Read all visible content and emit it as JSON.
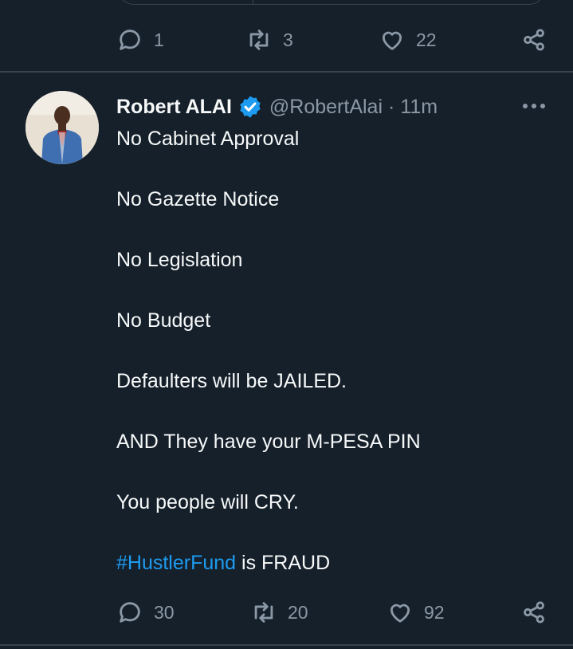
{
  "previous_tweet": {
    "actions": {
      "replies": "1",
      "retweets": "3",
      "likes": "22"
    }
  },
  "tweet": {
    "author": {
      "name": "Robert ALAI",
      "handle": "@RobertAlai"
    },
    "separator": "·",
    "time": "11m",
    "lines": [
      "No Cabinet Approval",
      "No Gazette Notice",
      "No Legislation",
      "No Budget",
      "Defaulters will be JAILED.",
      "AND They have your M-PESA PIN",
      "You people will CRY."
    ],
    "last_line": {
      "hashtag": "#HustlerFund",
      "rest": " is FRAUD"
    },
    "actions": {
      "replies": "30",
      "retweets": "20",
      "likes": "92"
    }
  },
  "colors": {
    "background": "#15202b",
    "text": "#f7f9f9",
    "muted": "#8b98a5",
    "accent": "#1d9bf0",
    "border": "#38444d"
  },
  "icons": [
    "reply-icon",
    "retweet-icon",
    "like-icon",
    "share-icon",
    "verified-badge-icon",
    "more-icon"
  ]
}
